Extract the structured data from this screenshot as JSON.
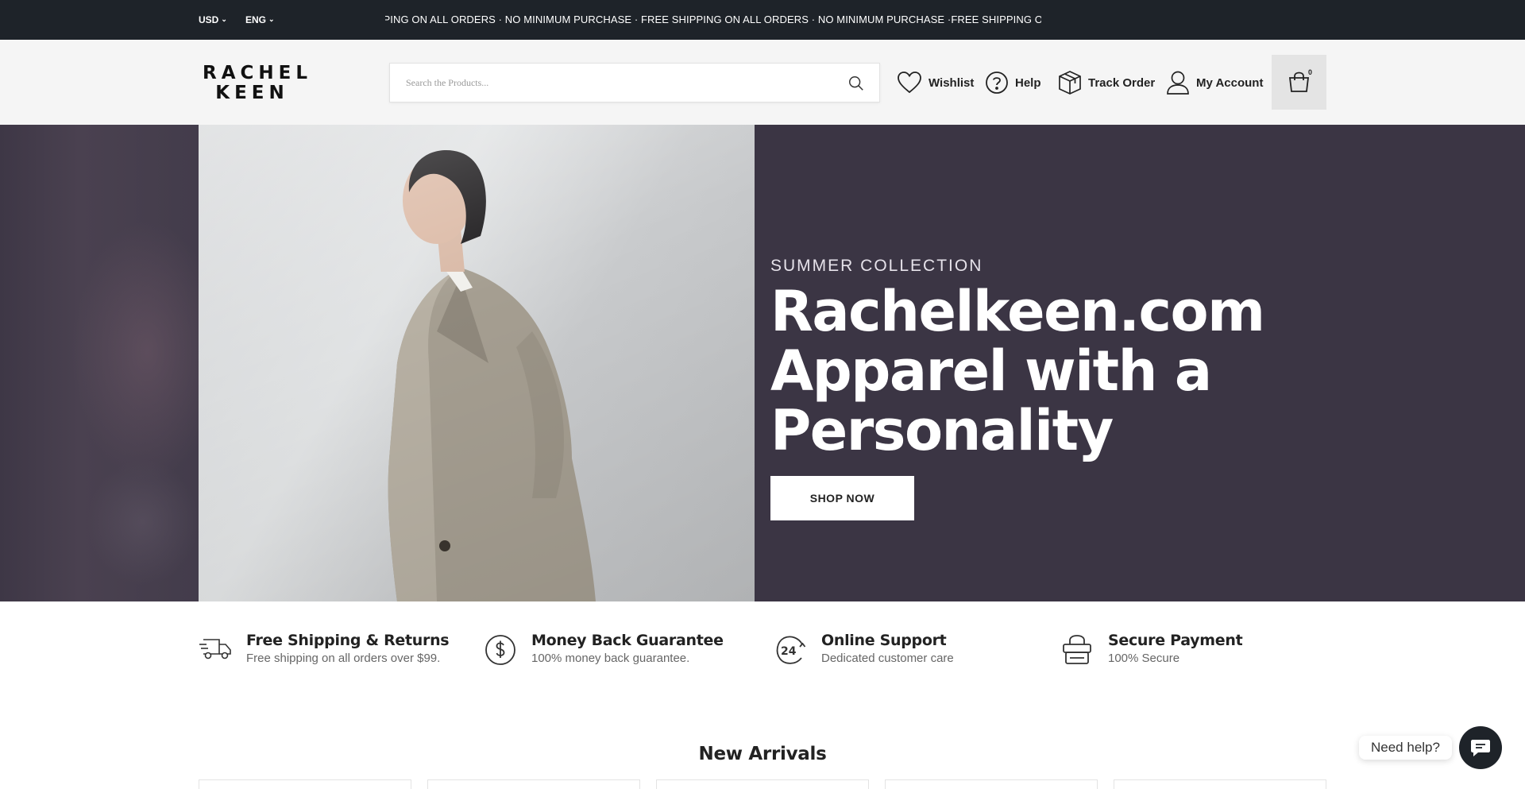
{
  "topbar": {
    "currency": "USD",
    "language": "ENG",
    "announcement": "IPPING ON ALL ORDERS · NO MINIMUM PURCHASE · FREE SHIPPING ON ALL ORDERS · NO MINIMUM PURCHASE ·FREE SHIPPING ON ALL ORDE",
    "background": "#1e2329"
  },
  "header": {
    "logo_line1": "RACHEL",
    "logo_line2": "KEEN",
    "search_placeholder": "Search the Products...",
    "links": {
      "wishlist": "Wishlist",
      "help": "Help",
      "track_order": "Track Order",
      "my_account": "My Account"
    },
    "cart_count": "0"
  },
  "hero": {
    "eyebrow": "SUMMER COLLECTION",
    "headline_line1": "Rachelkeen.com",
    "headline_line2": "Apparel with a",
    "headline_line3": "Personality",
    "cta": "SHOP NOW",
    "background": "#3b3544"
  },
  "features": [
    {
      "icon": "delivery-truck-icon",
      "title": "Free Shipping & Returns",
      "desc": "Free shipping on all orders over $99."
    },
    {
      "icon": "dollar-circle-icon",
      "title": "Money Back Guarantee",
      "desc": "100% money back guarantee."
    },
    {
      "icon": "24h-support-icon",
      "title": "Online Support",
      "desc": "Dedicated customer care"
    },
    {
      "icon": "secure-payment-icon",
      "title": "Secure Payment",
      "desc": "100% Secure"
    }
  ],
  "new_arrivals": {
    "title": "New Arrivals"
  },
  "chat": {
    "bubble": "Need help?"
  }
}
